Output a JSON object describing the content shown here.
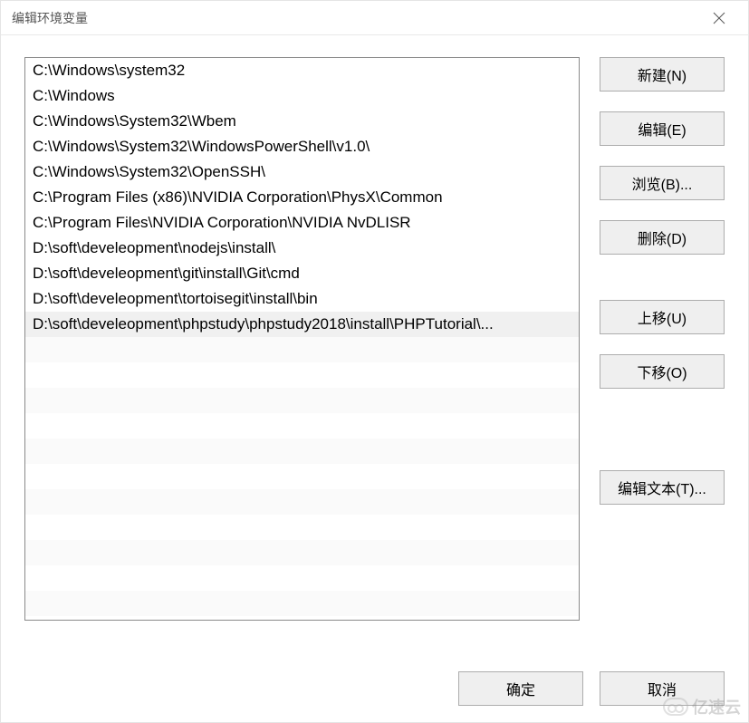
{
  "window": {
    "title": "编辑环境变量"
  },
  "list": {
    "items": [
      "C:\\Windows\\system32",
      "C:\\Windows",
      "C:\\Windows\\System32\\Wbem",
      "C:\\Windows\\System32\\WindowsPowerShell\\v1.0\\",
      "C:\\Windows\\System32\\OpenSSH\\",
      "C:\\Program Files (x86)\\NVIDIA Corporation\\PhysX\\Common",
      "C:\\Program Files\\NVIDIA Corporation\\NVIDIA NvDLISR",
      "D:\\soft\\develeopment\\nodejs\\install\\",
      "D:\\soft\\develeopment\\git\\install\\Git\\cmd",
      "D:\\soft\\develeopment\\tortoisegit\\install\\bin",
      "D:\\soft\\develeopment\\phpstudy\\phpstudy2018\\install\\PHPTutorial\\..."
    ],
    "selected_index": 10
  },
  "buttons": {
    "new": "新建(N)",
    "edit": "编辑(E)",
    "browse": "浏览(B)...",
    "delete": "删除(D)",
    "move_up": "上移(U)",
    "move_down": "下移(O)",
    "edit_text": "编辑文本(T)...",
    "ok": "确定",
    "cancel": "取消"
  },
  "watermark": {
    "text": "亿速云"
  }
}
